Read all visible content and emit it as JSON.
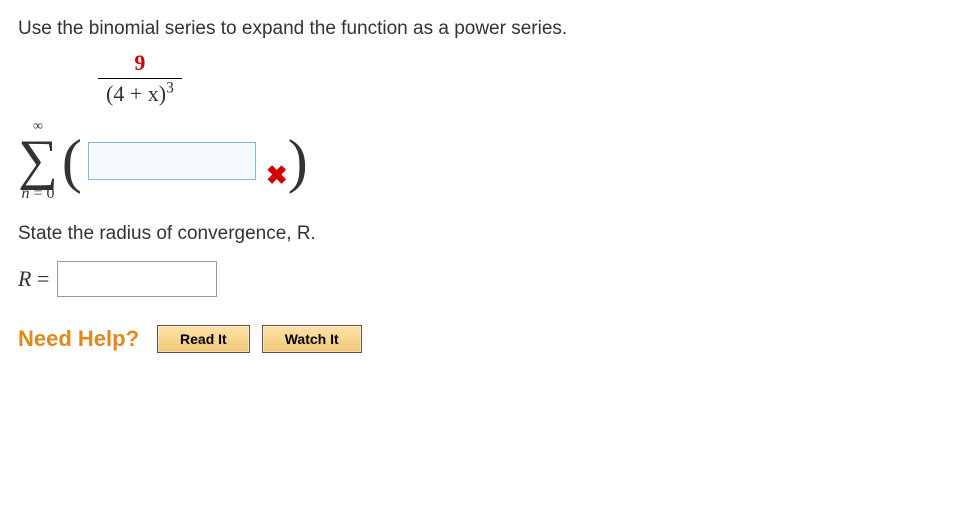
{
  "prompt": "Use the binomial series to expand the function as a power series.",
  "fraction": {
    "numerator": "9",
    "denominator_base": "(4 + x)",
    "denominator_exp": "3"
  },
  "summation": {
    "upper": "∞",
    "lower_var": "n",
    "lower_eq": " = ",
    "lower_val": "0",
    "paren_open": "(",
    "paren_close": ")",
    "answer_value": "",
    "mark_symbol": "✖"
  },
  "second_prompt": "State the radius of convergence, R.",
  "radius": {
    "label_var": "R",
    "label_eq": " = ",
    "value": ""
  },
  "help": {
    "label": "Need Help?",
    "read_btn": "Read It",
    "watch_btn": "Watch It"
  }
}
